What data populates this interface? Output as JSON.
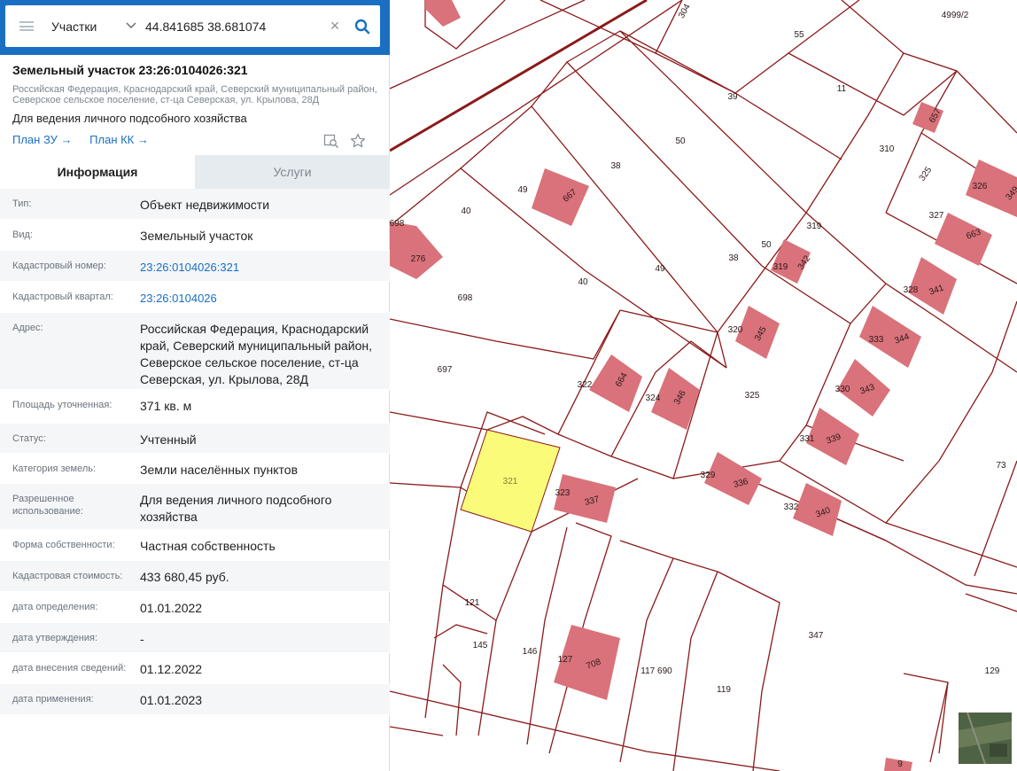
{
  "search": {
    "layer": "Участки",
    "value": "44.841685 38.681074",
    "clear_glyph": "×"
  },
  "object": {
    "title": "Земельный участок 23:26:0104026:321",
    "address": "Российская Федерация, Краснодарский край, Северский муниципальный район, Северское сельское поселение, ст-ца Северская, ул. Крылова, 28Д",
    "purpose": "Для ведения личного подсобного хозяйства",
    "link_plan_zu": "План ЗУ →",
    "link_plan_kk": "План КК →"
  },
  "tabs": {
    "info": "Информация",
    "services": "Услуги"
  },
  "rows": [
    {
      "label": "Тип:",
      "value": "Объект недвижимости"
    },
    {
      "label": "Вид:",
      "value": "Земельный участок"
    },
    {
      "label": "Кадастровый номер:",
      "value": "23:26:0104026:321"
    },
    {
      "label": "Кадастровый квартал:",
      "value": "23:26:0104026"
    },
    {
      "label": "Адрес:",
      "value": "Российская Федерация, Краснодарский край, Северский муниципальный район, Северское сельское поселение, ст-ца Северская, ул. Крылова, 28Д"
    },
    {
      "label": "Площадь уточненная:",
      "value": "371 кв. м"
    },
    {
      "label": "Статус:",
      "value": "Учтенный"
    },
    {
      "label": "Категория земель:",
      "value": "Земли населённых пунктов"
    },
    {
      "label": "Разрешенное использование:",
      "value": "Для ведения личного подсобного хозяйства"
    },
    {
      "label": "Форма собственности:",
      "value": "Частная собственность"
    },
    {
      "label": "Кадастровая стоимость:",
      "value": "433 680,45 руб."
    },
    {
      "label": "дата определения:",
      "value": "01.01.2022"
    },
    {
      "label": "дата утверждения:",
      "value": "-"
    },
    {
      "label": "дата внесения сведений:",
      "value": "01.12.2022"
    },
    {
      "label": "дата применения:",
      "value": "01.01.2023"
    }
  ],
  "map": {
    "parcel_labels": [
      "304",
      "4999/2",
      "55",
      "39",
      "11",
      "50",
      "667",
      "657",
      "310",
      "38",
      "49",
      "325",
      "326",
      "349",
      "40",
      "319",
      "327",
      "663",
      "276",
      "698",
      "342",
      "50",
      "38",
      "319",
      "328",
      "341",
      "49",
      "40",
      "698",
      "345",
      "320",
      "333",
      "344",
      "697",
      "664",
      "322",
      "324",
      "346",
      "325",
      "330",
      "343",
      "331",
      "339",
      "321",
      "73",
      "323",
      "337",
      "329",
      "336",
      "332",
      "340",
      "121",
      "145",
      "146",
      "127",
      "708",
      "117 690",
      "347",
      "119",
      "129",
      "9"
    ],
    "highlight_label": "321",
    "colors": {
      "boundary": "#8b1a1a",
      "building": "#d9727a",
      "highlight": "#fbfb7a"
    }
  },
  "icons": {
    "menu": "hamburger-icon",
    "dropdown": "chevron-down-icon",
    "clear": "close-icon",
    "search": "search-icon",
    "collapse": "chevron-left-icon",
    "find": "find-on-map-icon",
    "favorite": "star-icon"
  }
}
